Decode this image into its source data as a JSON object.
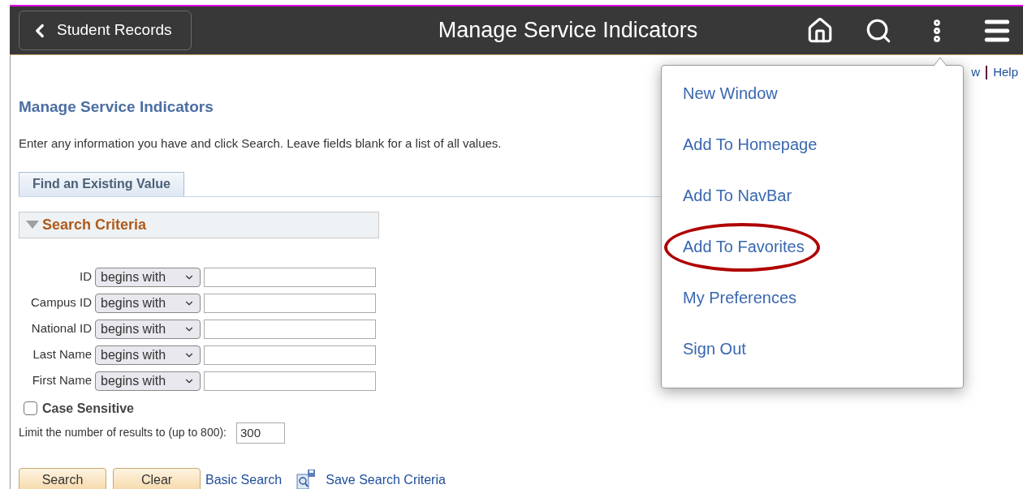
{
  "header": {
    "back_button": "Student Records",
    "title": "Manage Service Indicators"
  },
  "top_links": [
    "w",
    "Help"
  ],
  "page_title": "Manage Service Indicators",
  "instructions": "Enter any information you have and click Search. Leave fields blank for a list of all values.",
  "tabs": [
    {
      "label": "Find an Existing Value",
      "selected": true
    }
  ],
  "section": {
    "title": "Search Criteria",
    "expanded": true
  },
  "criteria": [
    {
      "label": "ID",
      "operator": "begins with"
    },
    {
      "label": "Campus ID",
      "operator": "begins with"
    },
    {
      "label": "National ID",
      "operator": "begins with"
    },
    {
      "label": "Last Name",
      "operator": "begins with"
    },
    {
      "label": "First Name",
      "operator": "begins with"
    }
  ],
  "case_sensitive": {
    "label": "Case Sensitive",
    "checked": false
  },
  "limit": {
    "label": "Limit the number of results to (up to 800):",
    "value": "300"
  },
  "buttons": [
    "Search",
    "Clear"
  ],
  "links": [
    "Basic Search",
    "Save Search Criteria"
  ],
  "menu": {
    "items": [
      {
        "label": "New Window",
        "highlighted": false
      },
      {
        "label": "Add To Homepage",
        "highlighted": false
      },
      {
        "label": "Add To NavBar",
        "highlighted": false
      },
      {
        "label": "Add To Favorites",
        "highlighted": true
      },
      {
        "label": "My Preferences",
        "highlighted": false
      },
      {
        "label": "Sign Out",
        "highlighted": false
      }
    ]
  }
}
